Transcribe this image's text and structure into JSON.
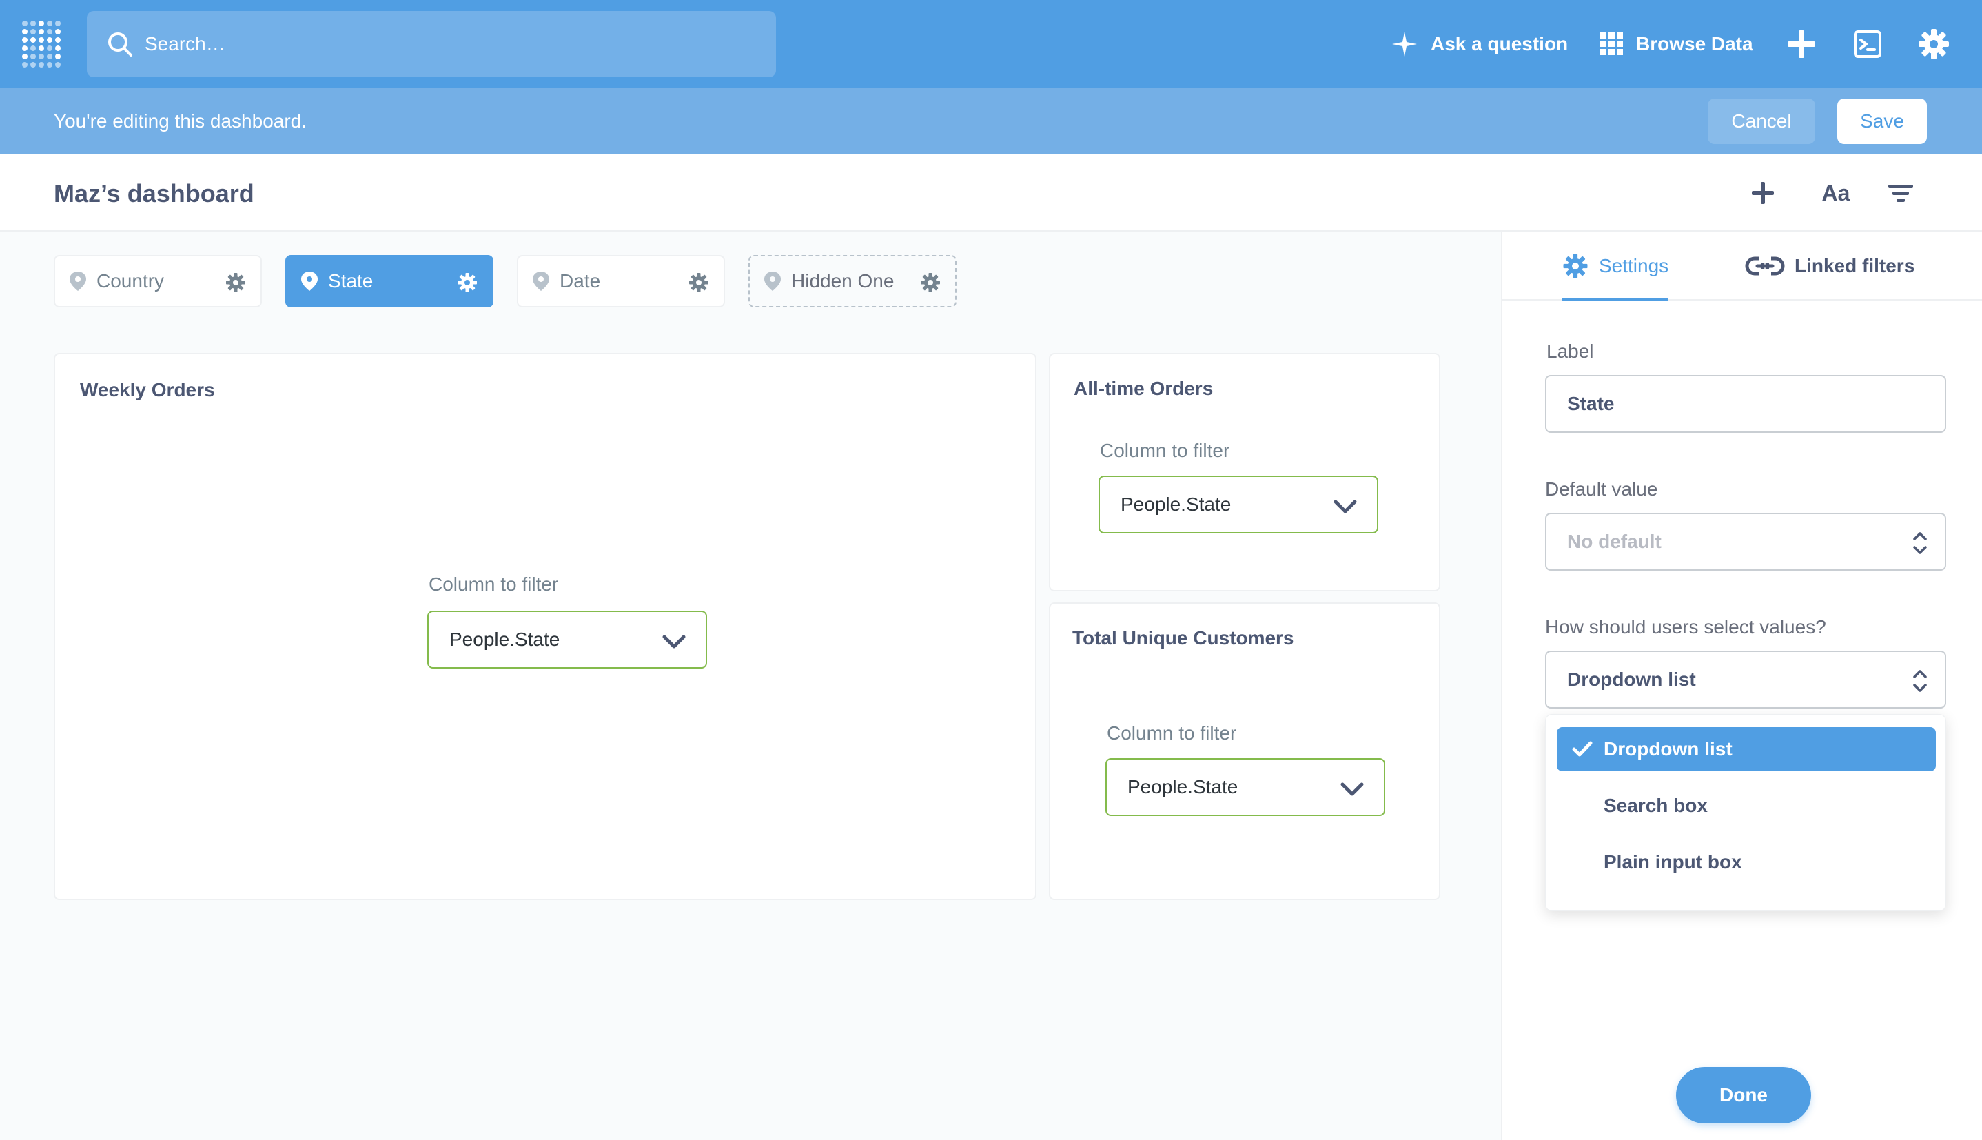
{
  "nav": {
    "search_placeholder": "Search…",
    "ask_label": "Ask a question",
    "browse_label": "Browse Data"
  },
  "editbar": {
    "message": "You're editing this dashboard.",
    "cancel_label": "Cancel",
    "save_label": "Save"
  },
  "header": {
    "title": "Maz’s dashboard",
    "text_icon_label": "Aa"
  },
  "filters": [
    {
      "label": "Country",
      "state": "normal"
    },
    {
      "label": "State",
      "state": "active"
    },
    {
      "label": "Date",
      "state": "normal"
    },
    {
      "label": "Hidden One",
      "state": "hidden"
    }
  ],
  "cards": {
    "weekly": {
      "title": "Weekly Orders",
      "column_label": "Column to filter",
      "column_value": "People.State"
    },
    "alltime": {
      "title": "All-time Orders",
      "column_label": "Column to filter",
      "column_value": "People.State"
    },
    "unique": {
      "title": "Total Unique Customers",
      "column_label": "Column to filter",
      "column_value": "People.State"
    }
  },
  "sidebar": {
    "tabs": [
      {
        "label": "Settings",
        "active": true
      },
      {
        "label": "Linked filters",
        "active": false
      }
    ],
    "label_field": {
      "label": "Label",
      "value": "State"
    },
    "default_field": {
      "label": "Default value",
      "value": "No default"
    },
    "select_field": {
      "label": "How should users select values?",
      "value": "Dropdown list"
    },
    "options": [
      {
        "label": "Dropdown list",
        "selected": true
      },
      {
        "label": "Search box",
        "selected": false
      },
      {
        "label": "Plain input box",
        "selected": false
      }
    ],
    "done_label": "Done"
  },
  "colors": {
    "brand": "#509ee3",
    "valid_border": "#84bb4c"
  }
}
